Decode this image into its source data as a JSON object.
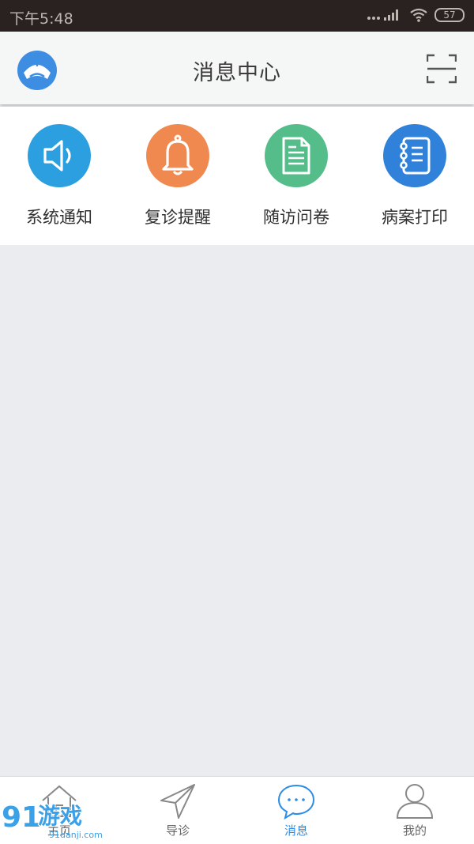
{
  "status_bar": {
    "time": "下午5:48",
    "battery": "57"
  },
  "header": {
    "title": "消息中心"
  },
  "quick_actions": [
    {
      "label": "系统通知",
      "icon": "speaker-icon",
      "color": "#2c9fe0"
    },
    {
      "label": "复诊提醒",
      "icon": "bell-icon",
      "color": "#f0894f"
    },
    {
      "label": "随访问卷",
      "icon": "document-icon",
      "color": "#54bd8a"
    },
    {
      "label": "病案打印",
      "icon": "notebook-icon",
      "color": "#2f81d9"
    }
  ],
  "tabs": [
    {
      "label": "主页",
      "icon": "home-icon"
    },
    {
      "label": "导诊",
      "icon": "navigation-icon"
    },
    {
      "label": "消息",
      "icon": "chat-icon",
      "active": true
    },
    {
      "label": "我的",
      "icon": "user-icon"
    }
  ],
  "watermark": {
    "text": "91游戏",
    "subtext": "91danji.com"
  }
}
